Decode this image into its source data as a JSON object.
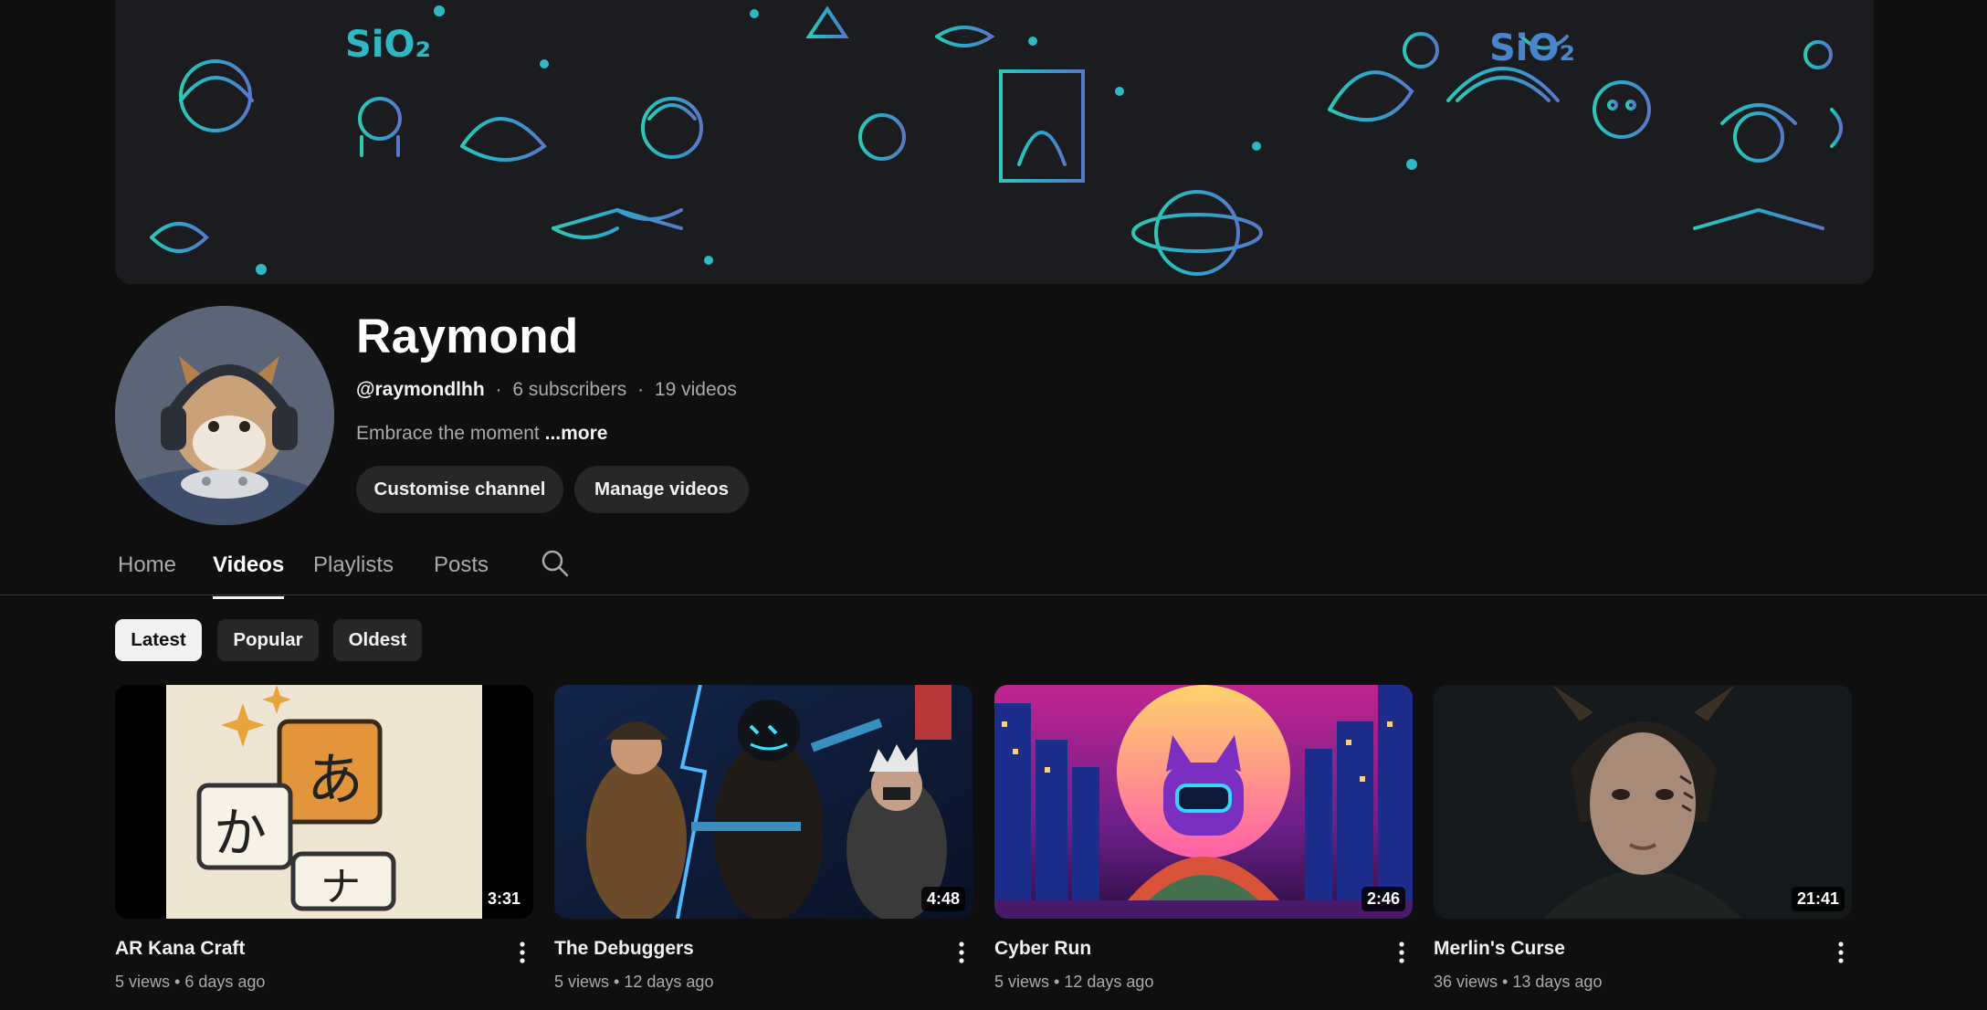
{
  "channel": {
    "name": "Raymond",
    "handle": "@raymondlhh",
    "subscribers": "6 subscribers",
    "videos_count": "19 videos",
    "separator": "·",
    "description": "Embrace the moment",
    "more_label": "...more",
    "avatar_icon": "cat-with-headphones-avatar",
    "banner_icon": "doodle-pattern-banner"
  },
  "buttons": {
    "customise": "Customise channel",
    "manage": "Manage videos"
  },
  "tabs": [
    {
      "label": "Home",
      "active": false
    },
    {
      "label": "Videos",
      "active": true
    },
    {
      "label": "Playlists",
      "active": false
    },
    {
      "label": "Posts",
      "active": false
    }
  ],
  "search_icon": "search-icon",
  "chips": [
    {
      "label": "Latest",
      "active": true
    },
    {
      "label": "Popular",
      "active": false
    },
    {
      "label": "Oldest",
      "active": false
    }
  ],
  "videos": [
    {
      "title": "AR Kana Craft",
      "duration": "3:31",
      "views": "5 views",
      "age": "6 days ago"
    },
    {
      "title": "The Debuggers",
      "duration": "4:48",
      "views": "5 views",
      "age": "12 days ago"
    },
    {
      "title": "Cyber Run",
      "duration": "2:46",
      "views": "5 views",
      "age": "12 days ago"
    },
    {
      "title": "Merlin's Curse",
      "duration": "21:41",
      "views": "36 views",
      "age": "13 days ago"
    }
  ],
  "meta_dot": "•",
  "colors": {
    "background": "#0f0f0f",
    "chip": "#272727",
    "chip_active": "#f1f1f1",
    "banner_teal": "#2ec4b6",
    "banner_blue": "#3b8fd6"
  }
}
